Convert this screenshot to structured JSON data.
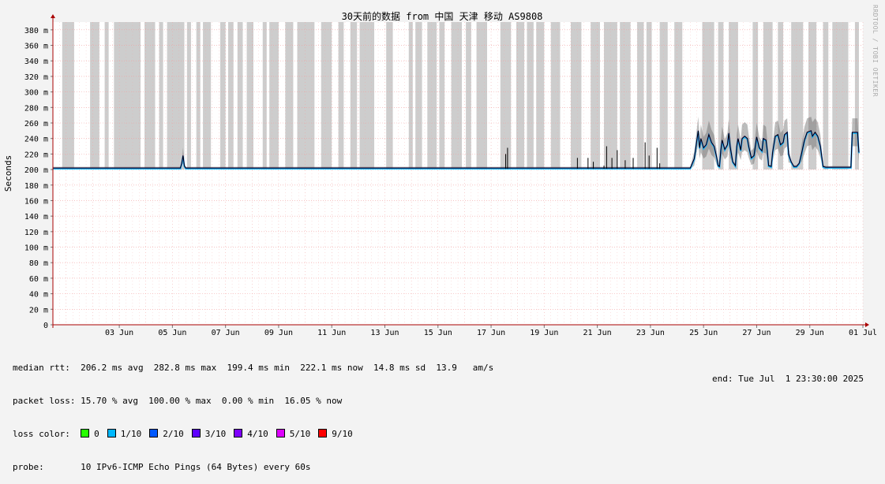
{
  "chart_data": {
    "type": "line",
    "title": "30天前的数据 from 中国 天津 移动 AS9808",
    "ylabel": "Seconds",
    "watermark": "RRDTOOL / TOBI OETIKER",
    "yticks": [
      "0",
      "20 m",
      "40 m",
      "60 m",
      "80 m",
      "100 m",
      "120 m",
      "140 m",
      "160 m",
      "180 m",
      "200 m",
      "220 m",
      "240 m",
      "260 m",
      "280 m",
      "300 m",
      "320 m",
      "340 m",
      "360 m",
      "380 m"
    ],
    "ylim_ms": [
      0,
      390
    ],
    "xlim_day": [
      0,
      30.5
    ],
    "xticks": [
      {
        "day": 2.5,
        "label": "03 Jun"
      },
      {
        "day": 4.5,
        "label": "05 Jun"
      },
      {
        "day": 6.5,
        "label": "07 Jun"
      },
      {
        "day": 8.5,
        "label": "09 Jun"
      },
      {
        "day": 10.5,
        "label": "11 Jun"
      },
      {
        "day": 12.5,
        "label": "13 Jun"
      },
      {
        "day": 14.5,
        "label": "15 Jun"
      },
      {
        "day": 16.5,
        "label": "17 Jun"
      },
      {
        "day": 18.5,
        "label": "19 Jun"
      },
      {
        "day": 20.5,
        "label": "21 Jun"
      },
      {
        "day": 22.5,
        "label": "23 Jun"
      },
      {
        "day": 24.5,
        "label": "25 Jun"
      },
      {
        "day": 26.5,
        "label": "27 Jun"
      },
      {
        "day": 28.5,
        "label": "29 Jun"
      },
      {
        "day": 30.5,
        "label": "01 Jul"
      }
    ],
    "loss_bands_day": [
      [
        0.35,
        0.8
      ],
      [
        1.4,
        1.75
      ],
      [
        1.95,
        2.1
      ],
      [
        2.3,
        3.3
      ],
      [
        3.45,
        3.85
      ],
      [
        4.0,
        4.15
      ],
      [
        4.3,
        4.95
      ],
      [
        5.05,
        5.2
      ],
      [
        5.4,
        5.55
      ],
      [
        5.65,
        5.95
      ],
      [
        6.3,
        6.5
      ],
      [
        6.6,
        6.8
      ],
      [
        6.95,
        7.15
      ],
      [
        7.3,
        7.55
      ],
      [
        7.9,
        8.05
      ],
      [
        8.15,
        8.5
      ],
      [
        8.75,
        9.05
      ],
      [
        9.2,
        9.85
      ],
      [
        10.1,
        10.5
      ],
      [
        10.75,
        10.95
      ],
      [
        11.2,
        11.45
      ],
      [
        11.55,
        12.1
      ],
      [
        12.55,
        12.8
      ],
      [
        13.4,
        13.55
      ],
      [
        13.65,
        13.9
      ],
      [
        14.1,
        14.45
      ],
      [
        14.55,
        14.75
      ],
      [
        15.0,
        15.4
      ],
      [
        15.55,
        15.75
      ],
      [
        15.95,
        16.35
      ],
      [
        16.85,
        17.25
      ],
      [
        17.45,
        17.75
      ],
      [
        17.85,
        18.1
      ],
      [
        18.2,
        18.5
      ],
      [
        18.75,
        19.1
      ],
      [
        19.5,
        19.9
      ],
      [
        20.25,
        20.6
      ],
      [
        20.75,
        21.25
      ],
      [
        21.35,
        21.75
      ],
      [
        22.0,
        22.25
      ],
      [
        22.35,
        22.55
      ],
      [
        22.85,
        23.15
      ],
      [
        23.4,
        23.7
      ],
      [
        24.45,
        24.9
      ],
      [
        25.05,
        25.25
      ],
      [
        25.45,
        25.8
      ],
      [
        26.35,
        26.55
      ],
      [
        26.75,
        27.1
      ],
      [
        27.3,
        27.5
      ],
      [
        27.8,
        28.25
      ],
      [
        28.45,
        28.75
      ],
      [
        29.0,
        29.2
      ],
      [
        29.35,
        29.95
      ],
      [
        30.2,
        30.35
      ]
    ],
    "median_rtt_ms": [
      [
        0,
        202
      ],
      [
        4.8,
        202
      ],
      [
        4.85,
        208
      ],
      [
        4.9,
        218
      ],
      [
        4.95,
        205
      ],
      [
        5.0,
        202
      ],
      [
        24.0,
        202
      ],
      [
        24.15,
        214
      ],
      [
        24.3,
        250
      ],
      [
        24.35,
        228
      ],
      [
        24.4,
        240
      ],
      [
        24.5,
        228
      ],
      [
        24.6,
        232
      ],
      [
        24.7,
        245
      ],
      [
        24.8,
        235
      ],
      [
        24.9,
        230
      ],
      [
        25.0,
        215
      ],
      [
        25.05,
        205
      ],
      [
        25.1,
        204
      ],
      [
        25.15,
        225
      ],
      [
        25.2,
        238
      ],
      [
        25.3,
        226
      ],
      [
        25.4,
        232
      ],
      [
        25.45,
        247
      ],
      [
        25.5,
        230
      ],
      [
        25.6,
        210
      ],
      [
        25.7,
        205
      ],
      [
        25.75,
        230
      ],
      [
        25.8,
        240
      ],
      [
        25.9,
        225
      ],
      [
        25.95,
        240
      ],
      [
        26.05,
        243
      ],
      [
        26.15,
        240
      ],
      [
        26.2,
        230
      ],
      [
        26.3,
        215
      ],
      [
        26.4,
        218
      ],
      [
        26.5,
        242
      ],
      [
        26.6,
        228
      ],
      [
        26.7,
        224
      ],
      [
        26.75,
        240
      ],
      [
        26.85,
        238
      ],
      [
        26.9,
        225
      ],
      [
        26.95,
        205
      ],
      [
        27.05,
        204
      ],
      [
        27.1,
        222
      ],
      [
        27.2,
        243
      ],
      [
        27.3,
        245
      ],
      [
        27.4,
        232
      ],
      [
        27.5,
        235
      ],
      [
        27.55,
        245
      ],
      [
        27.65,
        248
      ],
      [
        27.7,
        220
      ],
      [
        27.8,
        210
      ],
      [
        27.9,
        204
      ],
      [
        28.0,
        204
      ],
      [
        28.1,
        208
      ],
      [
        28.2,
        222
      ],
      [
        28.3,
        238
      ],
      [
        28.4,
        248
      ],
      [
        28.55,
        250
      ],
      [
        28.6,
        243
      ],
      [
        28.7,
        248
      ],
      [
        28.8,
        243
      ],
      [
        28.9,
        230
      ],
      [
        29.0,
        204
      ],
      [
        29.1,
        203
      ],
      [
        30.0,
        203
      ],
      [
        30.05,
        203
      ],
      [
        30.1,
        248
      ],
      [
        30.2,
        248
      ],
      [
        30.3,
        248
      ],
      [
        30.35,
        222
      ]
    ],
    "spikes": [
      [
        17.05,
        220
      ],
      [
        17.12,
        228
      ],
      [
        19.75,
        215
      ],
      [
        20.15,
        215
      ],
      [
        20.35,
        210
      ],
      [
        20.75,
        205
      ],
      [
        20.85,
        230
      ],
      [
        21.05,
        215
      ],
      [
        21.25,
        225
      ],
      [
        21.55,
        212
      ],
      [
        21.85,
        215
      ],
      [
        22.3,
        235
      ],
      [
        22.45,
        218
      ],
      [
        22.75,
        228
      ],
      [
        22.85,
        208
      ]
    ],
    "colors": {
      "background": "#f3f3f3",
      "canvas": "#ffffff",
      "loss_band": "#cdcdcd",
      "grid": "#f2a0a0",
      "axis": "#aa0000",
      "median": "#000000",
      "smoke": "#6a6a6a"
    }
  },
  "stats": {
    "median_rtt": "median rtt:  206.2 ms avg  282.8 ms max  199.4 ms min  222.1 ms now  14.8 ms sd  13.9   am/s",
    "packet_loss": "packet loss: 15.70 % avg  100.00 % max  0.00 % min  16.05 % now",
    "loss_color_label": "loss color:",
    "loss_colors": [
      {
        "label": "0",
        "color": "#26ff00"
      },
      {
        "label": "1/10",
        "color": "#00b8ff"
      },
      {
        "label": "2/10",
        "color": "#0059ff"
      },
      {
        "label": "3/10",
        "color": "#5e00ff"
      },
      {
        "label": "4/10",
        "color": "#7e00ff"
      },
      {
        "label": "5/10",
        "color": "#dd00ff"
      },
      {
        "label": "9/10",
        "color": "#ff0000"
      }
    ],
    "probe": "probe:       10 IPv6-ICMP Echo Pings (64 Bytes) every 60s",
    "end": "end: Tue Jul  1 23:30:00 2025"
  }
}
